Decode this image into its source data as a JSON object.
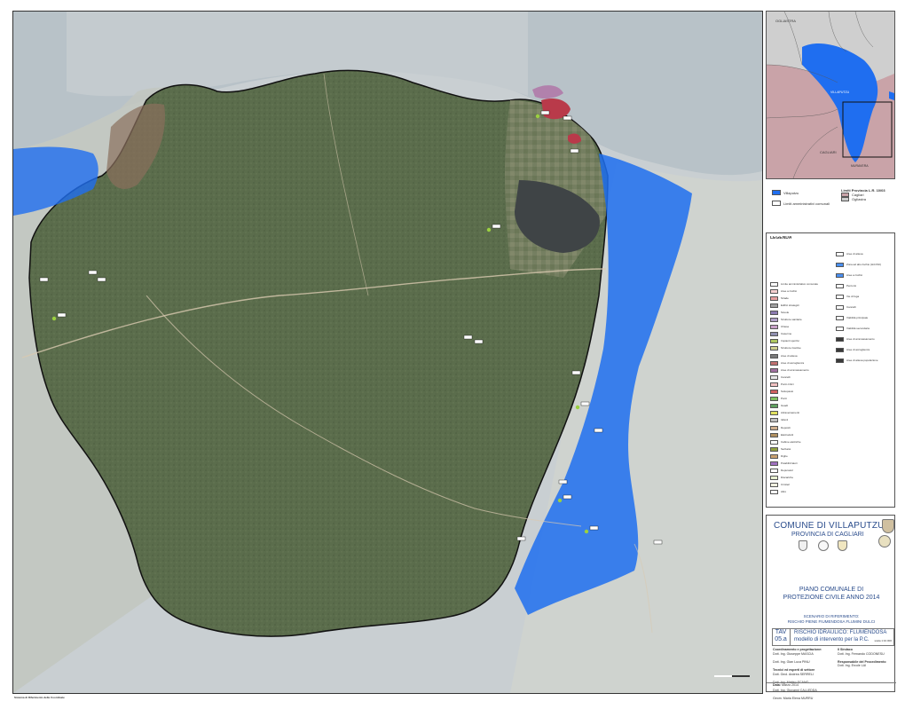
{
  "map": {
    "sea_color": "#b9c2c8",
    "terrain_color": "#5b6d4c",
    "risk_color": "#1f6ef0",
    "boundary_color": "#111111",
    "building_labels": [
      "",
      "",
      "",
      "",
      "",
      "",
      "",
      "",
      "",
      "",
      "",
      "",
      "",
      ""
    ],
    "scale_note": ""
  },
  "inset": {
    "labels": [
      "CAGLIARI",
      "OGLIASTRA",
      "VILLAPUTZU",
      "MURAVERA"
    ],
    "province_legend": [
      {
        "label": "Villaputzu",
        "color": "#1f6ef0"
      },
      {
        "label": "Limiti amministrativi comunali",
        "color": "#ffffff"
      }
    ],
    "province_title": "Limiti Provincia L.R. 10/03",
    "province_items": [
      {
        "label": "Cagliari",
        "color": "#c9a3a8"
      },
      {
        "label": "Ogliastra",
        "color": "#cccccc"
      }
    ]
  },
  "legend": {
    "title": "LEGENDA",
    "left_items": [
      {
        "label": "Limite amministrativo comunale",
        "color": "#ffffff"
      },
      {
        "label": "Aree a rischio",
        "color": "#f5d0d0"
      },
      {
        "label": "Strade",
        "color": "#e6a0a0"
      },
      {
        "label": "Edifici strategici",
        "color": "#a0a0a0"
      },
      {
        "label": "Scuole",
        "color": "#8c7bb0"
      },
      {
        "label": "Strutture sanitarie",
        "color": "#b0a0c8"
      },
      {
        "label": "Chiese",
        "color": "#c8a0c8"
      },
      {
        "label": "Caserme",
        "color": "#9090b0"
      },
      {
        "label": "Impianti sportivi",
        "color": "#b0c860"
      },
      {
        "label": "Strutture ricettive",
        "color": "#d0d090"
      },
      {
        "label": "Aree di attesa",
        "color": "#7a7a7a"
      },
      {
        "label": "Aree di accoglienza",
        "color": "#c07070"
      },
      {
        "label": "Aree di ammassamento",
        "color": "#a070a0"
      },
      {
        "label": "Cancelli",
        "color": "#e8e8e8"
      },
      {
        "label": "Punti critici",
        "color": "#f0c0c0"
      },
      {
        "label": "Sottopassi",
        "color": "#d06060"
      },
      {
        "label": "Ponti",
        "color": "#80c060"
      },
      {
        "label": "Guadi",
        "color": "#60a060"
      },
      {
        "label": "Attraversamenti",
        "color": "#e0e060"
      },
      {
        "label": "Idranti",
        "color": "#c0c0c0"
      },
      {
        "label": "Depositi",
        "color": "#d0b090"
      },
      {
        "label": "Elettrodotti",
        "color": "#b09060"
      },
      {
        "label": "Cabine elettriche",
        "color": "#ffffff"
      },
      {
        "label": "Serbatoi",
        "color": "#90a040"
      },
      {
        "label": "Dighe",
        "color": "#c8a070"
      },
      {
        "label": "Potabilizzatori",
        "color": "#a070c0"
      },
      {
        "label": "Depuratori",
        "color": "#ffffff"
      },
      {
        "label": "Discariche",
        "color": "#e8f0d0"
      },
      {
        "label": "Cimiteri",
        "color": "#f0f0e0"
      },
      {
        "label": "Altro",
        "color": "#ffffff"
      }
    ],
    "right_items": [
      {
        "label": "Aree di attesa",
        "color": "#ffffff"
      },
      {
        "label": "Zona ad alto rischio (Hi4 PAI)",
        "color": "#4a8ff0"
      },
      {
        "label": "Aree a rischio",
        "color": "#4a8ff0"
      },
      {
        "label": "Percorsi",
        "color": "#ffffff"
      },
      {
        "label": "Vie di fuga",
        "color": "#ffffff"
      },
      {
        "label": "Cancelli",
        "color": "#ffffff"
      },
      {
        "label": "Viabilità principale",
        "color": "#ffffff"
      },
      {
        "label": "Viabilità secondaria",
        "color": "#ffffff"
      },
      {
        "label": "Aree di ammassamento",
        "color": "#3a3a3a"
      },
      {
        "label": "Aree di accoglienza",
        "color": "#3a3a3a"
      },
      {
        "label": "Aree di attesa popolazione",
        "color": "#3a3a3a"
      }
    ],
    "right_headers": [
      "Zona ad alto rischio (Hi4 PAI)",
      "CANCELLI"
    ],
    "note": ""
  },
  "titleblock": {
    "comune": "COMUNE DI VILLAPUTZU",
    "provincia": "PROVINCIA DI CAGLIARI",
    "plan_line1": "PIANO COMUNALE DI",
    "plan_line2": "PROTEZIONE CIVILE ANNO 2014",
    "scenario_line1": "SCENARIO DI RIFERIMENTO:",
    "scenario_line2": "RISCHIO PIENE FIUMENDOSA FLUMINI DULCI",
    "tav_label": "TAV",
    "tav_number": "05.a",
    "rischio": "RISCHIO IDRAULICO: FLUMENDOSA",
    "modello": "modello di intervento per la P.C.",
    "scale": "scala 1:10.000",
    "coordinamento_title": "Coordinamento e progettazione:",
    "coordinamento": [
      "Dott. Ing. Giuseppe MASCIA",
      "Dott. Ing. Gian Luca PINU"
    ],
    "tecnici_title": "Tecnici ed esperti di settore",
    "tecnici": [
      "Dott. Geol. Andrea SERRELI",
      "Dott. Ing. Matteo SCANO",
      "Dott. Ing. Giovanni CALLEDDA",
      "Geom. Maria Elena MURRU"
    ],
    "sindaco_title": "Il Sindaco",
    "sindaco": "Dott. Ing. Fernando CODONESU",
    "responsabile_title": "Responsabile del Procedimento",
    "responsabile": "Dott. Ing. Ercole LAI",
    "data_title": "Data:",
    "data": "Marzo 2014"
  },
  "footer": {
    "system": "Sistema di Riferimento delle Coordinate",
    "system_detail": ""
  }
}
